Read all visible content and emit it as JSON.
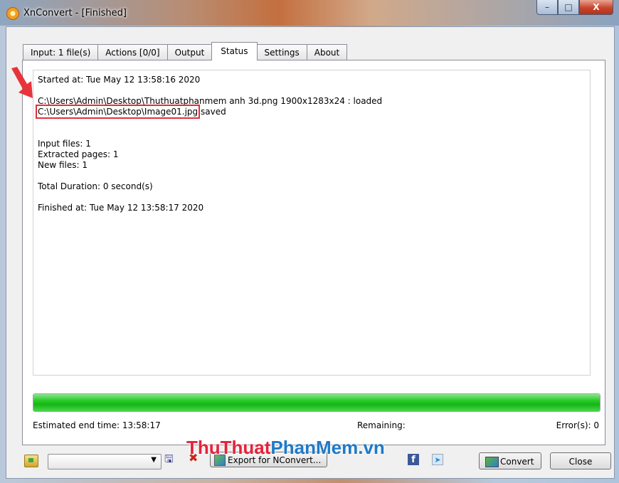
{
  "window": {
    "title": "XnConvert - [Finished]",
    "controls": {
      "minimize": "–",
      "maximize": "□",
      "close": "X"
    }
  },
  "tabs": [
    {
      "label": "Input: 1 file(s)"
    },
    {
      "label": "Actions [0/0]"
    },
    {
      "label": "Output"
    },
    {
      "label": "Status"
    },
    {
      "label": "Settings"
    },
    {
      "label": "About"
    }
  ],
  "active_tab": "Status",
  "log": {
    "started": "Started at: Tue May 12 13:58:16 2020",
    "line_loaded": "C:\\Users\\Admin\\Desktop\\Thuthuatphanmem anh 3d.png 1900x1283x24 : loaded",
    "saved_path": "C:\\Users\\Admin\\Desktop\\Image01.jpg",
    "saved_suffix": " saved",
    "input_files": "Input files: 1",
    "extracted_pages": "Extracted pages: 1",
    "new_files": "New files: 1",
    "total_duration": "Total Duration: 0 second(s)",
    "finished": "Finished at: Tue May 12 13:58:17 2020"
  },
  "progress": {
    "fraction": 1.0,
    "color": "#1cc21c"
  },
  "status": {
    "estimated": "Estimated end time:  13:58:17",
    "remaining": "Remaining:",
    "errors": "Error(s):  0"
  },
  "toolbar": {
    "export_label": "Export for NConvert...",
    "convert_label": "Convert",
    "close_label": "Close",
    "preset_value": ""
  },
  "watermark": {
    "part1": "ThuThuat",
    "part2": "PhanMem.vn"
  },
  "colors": {
    "highlight": "#e0303c",
    "arrow": "#e8333b"
  }
}
